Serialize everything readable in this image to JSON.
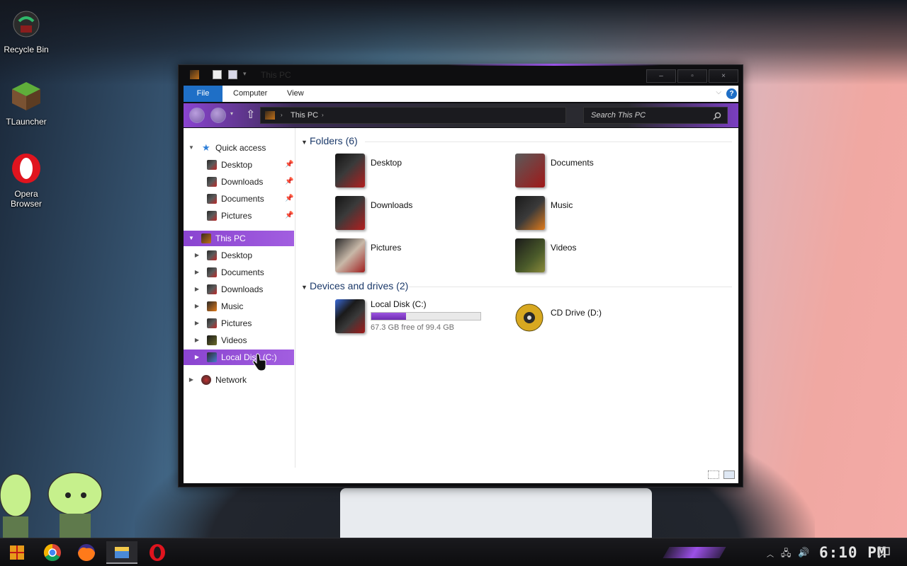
{
  "desktop": {
    "icons": [
      {
        "label": "Recycle Bin"
      },
      {
        "label": "TLauncher"
      },
      {
        "label": "Opera Browser"
      }
    ]
  },
  "window": {
    "title": "This PC",
    "controls": {
      "minimize": "–",
      "maximize": "▫",
      "close": "×"
    },
    "ribbon_tabs": [
      "File",
      "Computer",
      "View"
    ],
    "help_label": "?",
    "address": {
      "crumb": "This PC"
    },
    "search_placeholder": "Search This PC"
  },
  "nav_pane": {
    "quick_access": {
      "label": "Quick access",
      "items": [
        "Desktop",
        "Downloads",
        "Documents",
        "Pictures"
      ]
    },
    "this_pc": {
      "label": "This PC",
      "items": [
        "Desktop",
        "Documents",
        "Downloads",
        "Music",
        "Pictures",
        "Videos",
        "Local Disk (C:)"
      ]
    },
    "network": {
      "label": "Network"
    }
  },
  "main": {
    "folders_header": "Folders (6)",
    "folders": [
      "Desktop",
      "Documents",
      "Downloads",
      "Music",
      "Pictures",
      "Videos"
    ],
    "devices_header": "Devices and drives (2)",
    "drives": [
      {
        "name": "Local Disk (C:)",
        "free_text": "67.3 GB free of 99.4 GB",
        "used_fraction": 0.32
      },
      {
        "name": "CD Drive (D:)"
      }
    ]
  },
  "taskbar": {
    "clock": "6:10 PM",
    "apps": [
      "start-icon",
      "chrome-icon",
      "firefox-icon",
      "file-explorer-icon",
      "opera-icon"
    ]
  },
  "colors": {
    "accent": "#8a44d0",
    "file_tab": "#1f6fc6"
  }
}
